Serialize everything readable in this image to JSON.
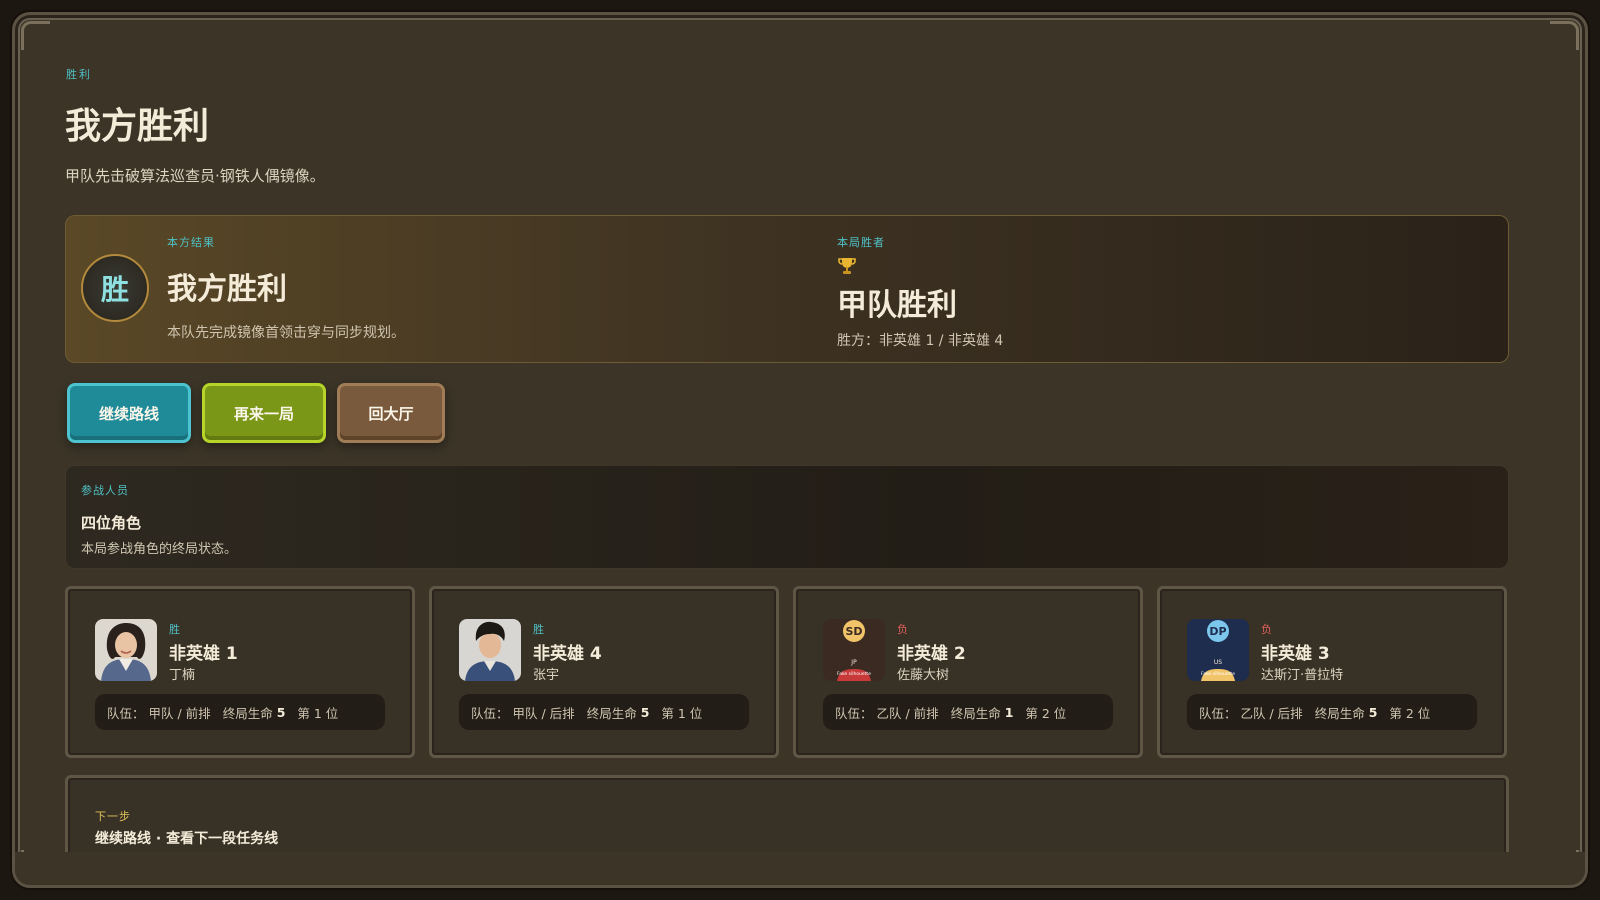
{
  "header": {
    "eyebrow": "胜利",
    "title": "我方胜利",
    "subtitle": "甲队先击破算法巡查员·钢铁人偶镜像。"
  },
  "result": {
    "badge": "胜",
    "label": "本方结果",
    "title": "我方胜利",
    "desc": "本队先完成镜像首领击穿与同步规划。",
    "winner_label": "本局胜者",
    "winner_icon": "trophy-icon",
    "winner_title": "甲队胜利",
    "winner_desc": "胜方：非英雄 1 / 非英雄 4"
  },
  "buttons": {
    "route": "继续路线",
    "again": "再来一局",
    "lobby": "回大厅"
  },
  "roster": {
    "label": "参战人员",
    "title": "四位角色",
    "desc": "本局参战角色的终局状态。"
  },
  "players": [
    {
      "status": "胜",
      "name": "非英雄 1",
      "player": "丁楠",
      "team_label": "队伍：",
      "team": "甲队 / 前排",
      "hp_label": "终局生命",
      "hp": "5",
      "rank": "第 1 位",
      "avatar": "photo-woman"
    },
    {
      "status": "胜",
      "name": "非英雄 4",
      "player": "张宇",
      "team_label": "队伍：",
      "team": "甲队 / 后排",
      "hp_label": "终局生命",
      "hp": "5",
      "rank": "第 1 位",
      "avatar": "photo-man"
    },
    {
      "status": "负",
      "name": "非英雄 2",
      "player": "佐藤大树",
      "team_label": "队伍：",
      "team": "乙队 / 前排",
      "hp_label": "终局生命",
      "hp": "1",
      "rank": "第 2 位",
      "avatar": "placeholder",
      "avatar_initials": "SD",
      "avatar_country": "JP",
      "avatar_caption": "Fake silhouette"
    },
    {
      "status": "负",
      "name": "非英雄 3",
      "player": "达斯汀·普拉特",
      "team_label": "队伍：",
      "team": "乙队 / 后排",
      "hp_label": "终局生命",
      "hp": "5",
      "rank": "第 2 位",
      "avatar": "placeholder",
      "avatar_initials": "DP",
      "avatar_country": "US",
      "avatar_caption": "Fake silhouette"
    }
  ],
  "next": {
    "label": "下一步",
    "title": "继续路线 · 查看下一段任务线"
  },
  "colors": {
    "accent_cyan": "#4fc2c6",
    "lose_red": "#e0605a",
    "gold": "#e0c15a",
    "btn_route": "#1f8a98",
    "btn_again": "#7b9718",
    "btn_lobby": "#7a5a3c"
  }
}
